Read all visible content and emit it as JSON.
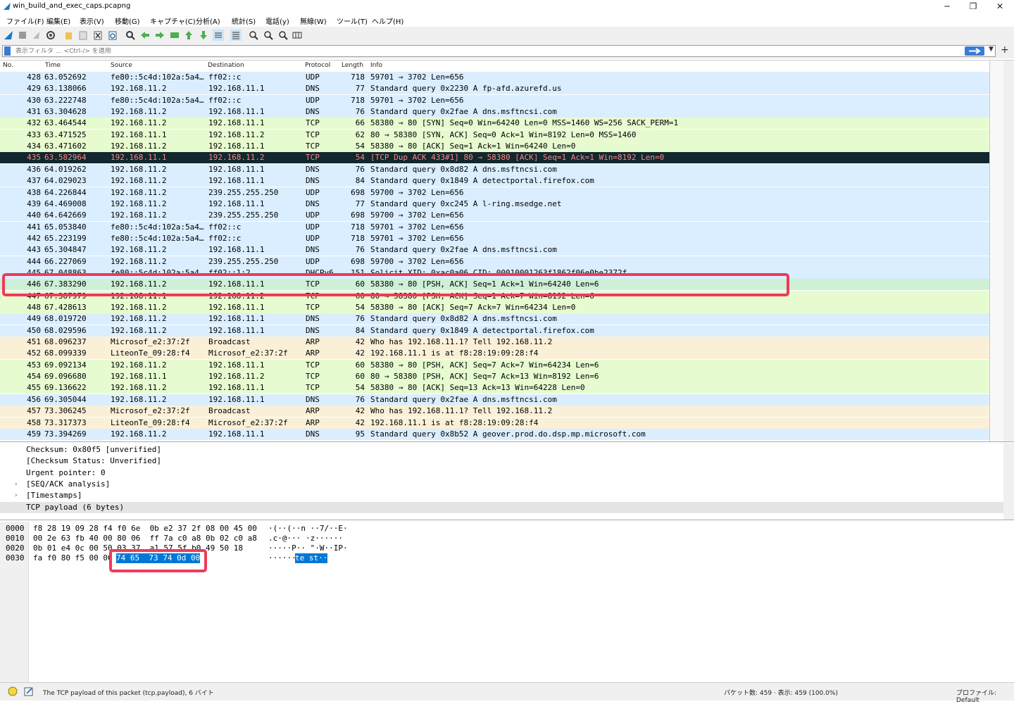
{
  "window": {
    "title": "win_build_and_exec_caps.pcapng",
    "minimize": "─",
    "restore": "❐",
    "close": "✕"
  },
  "menu": [
    "ファイル(F)",
    "編集(E)",
    "表示(V)",
    "移動(G)",
    "キャプチャ(C)",
    "分析(A)",
    "統計(S)",
    "電話(y)",
    "無線(W)",
    "ツール(T)",
    "ヘルプ(H)"
  ],
  "filter": {
    "placeholder": "表示フィルタ … <Ctrl-/> を適用"
  },
  "columns": {
    "no": "No.",
    "time": "Time",
    "source": "Source",
    "destination": "Destination",
    "protocol": "Protocol",
    "length": "Length",
    "info": "Info"
  },
  "packets": [
    {
      "no": "428",
      "time": "63.052692",
      "src": "fe80::5c4d:102a:5a4…",
      "dst": "ff02::c",
      "proto": "UDP",
      "len": "718",
      "info": "59701 → 3702 Len=656",
      "color": "udp"
    },
    {
      "no": "429",
      "time": "63.138066",
      "src": "192.168.11.2",
      "dst": "192.168.11.1",
      "proto": "DNS",
      "len": "77",
      "info": "Standard query 0x2230 A fp-afd.azurefd.us",
      "color": "udp"
    },
    {
      "no": "430",
      "time": "63.222748",
      "src": "fe80::5c4d:102a:5a4…",
      "dst": "ff02::c",
      "proto": "UDP",
      "len": "718",
      "info": "59701 → 3702 Len=656",
      "color": "udp"
    },
    {
      "no": "431",
      "time": "63.304628",
      "src": "192.168.11.2",
      "dst": "192.168.11.1",
      "proto": "DNS",
      "len": "76",
      "info": "Standard query 0x2fae A dns.msftncsi.com",
      "color": "udp"
    },
    {
      "no": "432",
      "time": "63.464544",
      "src": "192.168.11.2",
      "dst": "192.168.11.1",
      "proto": "TCP",
      "len": "66",
      "info": "58380 → 80 [SYN] Seq=0 Win=64240 Len=0 MSS=1460 WS=256 SACK_PERM=1",
      "color": "tcp"
    },
    {
      "no": "433",
      "time": "63.471525",
      "src": "192.168.11.1",
      "dst": "192.168.11.2",
      "proto": "TCP",
      "len": "62",
      "info": "80 → 58380 [SYN, ACK] Seq=0 Ack=1 Win=8192 Len=0 MSS=1460",
      "color": "tcp"
    },
    {
      "no": "434",
      "time": "63.471602",
      "src": "192.168.11.2",
      "dst": "192.168.11.1",
      "proto": "TCP",
      "len": "54",
      "info": "58380 → 80 [ACK] Seq=1 Ack=1 Win=64240 Len=0",
      "color": "tcp"
    },
    {
      "no": "435",
      "time": "63.582964",
      "src": "192.168.11.1",
      "dst": "192.168.11.2",
      "proto": "TCP",
      "len": "54",
      "info": "[TCP Dup ACK 433#1] 80 → 58380 [ACK] Seq=1 Ack=1 Win=8192 Len=0",
      "color": "dark"
    },
    {
      "no": "436",
      "time": "64.019262",
      "src": "192.168.11.2",
      "dst": "192.168.11.1",
      "proto": "DNS",
      "len": "76",
      "info": "Standard query 0x8d82 A dns.msftncsi.com",
      "color": "udp"
    },
    {
      "no": "437",
      "time": "64.029023",
      "src": "192.168.11.2",
      "dst": "192.168.11.1",
      "proto": "DNS",
      "len": "84",
      "info": "Standard query 0x1849 A detectportal.firefox.com",
      "color": "udp"
    },
    {
      "no": "438",
      "time": "64.226844",
      "src": "192.168.11.2",
      "dst": "239.255.255.250",
      "proto": "UDP",
      "len": "698",
      "info": "59700 → 3702 Len=656",
      "color": "udp"
    },
    {
      "no": "439",
      "time": "64.469008",
      "src": "192.168.11.2",
      "dst": "192.168.11.1",
      "proto": "DNS",
      "len": "77",
      "info": "Standard query 0xc245 A l-ring.msedge.net",
      "color": "udp"
    },
    {
      "no": "440",
      "time": "64.642669",
      "src": "192.168.11.2",
      "dst": "239.255.255.250",
      "proto": "UDP",
      "len": "698",
      "info": "59700 → 3702 Len=656",
      "color": "udp"
    },
    {
      "no": "441",
      "time": "65.053840",
      "src": "fe80::5c4d:102a:5a4…",
      "dst": "ff02::c",
      "proto": "UDP",
      "len": "718",
      "info": "59701 → 3702 Len=656",
      "color": "udp"
    },
    {
      "no": "442",
      "time": "65.223199",
      "src": "fe80::5c4d:102a:5a4…",
      "dst": "ff02::c",
      "proto": "UDP",
      "len": "718",
      "info": "59701 → 3702 Len=656",
      "color": "udp"
    },
    {
      "no": "443",
      "time": "65.304847",
      "src": "192.168.11.2",
      "dst": "192.168.11.1",
      "proto": "DNS",
      "len": "76",
      "info": "Standard query 0x2fae A dns.msftncsi.com",
      "color": "udp"
    },
    {
      "no": "444",
      "time": "66.227069",
      "src": "192.168.11.2",
      "dst": "239.255.255.250",
      "proto": "UDP",
      "len": "698",
      "info": "59700 → 3702 Len=656",
      "color": "udp"
    },
    {
      "no": "445",
      "time": "67.048863",
      "src": "fe80::5c4d:102a:5a4…",
      "dst": "ff02::1:2",
      "proto": "DHCPv6",
      "len": "151",
      "info": "Solicit XID: 0xac0a06 CID: 00010001263f1862f06e0be2372f",
      "color": "udp"
    },
    {
      "no": "446",
      "time": "67.383290",
      "src": "192.168.11.2",
      "dst": "192.168.11.1",
      "proto": "TCP",
      "len": "60",
      "info": "58380 → 80 [PSH, ACK] Seq=1 Ack=1 Win=64240 Len=6",
      "color": "selrow"
    },
    {
      "no": "447",
      "time": "67.387979",
      "src": "192.168.11.1",
      "dst": "192.168.11.2",
      "proto": "TCP",
      "len": "60",
      "info": "80 → 58380 [PSH, ACK] Seq=1 Ack=7 Win=8192 Len=6",
      "color": "tcp"
    },
    {
      "no": "448",
      "time": "67.428613",
      "src": "192.168.11.2",
      "dst": "192.168.11.1",
      "proto": "TCP",
      "len": "54",
      "info": "58380 → 80 [ACK] Seq=7 Ack=7 Win=64234 Len=0",
      "color": "tcp"
    },
    {
      "no": "449",
      "time": "68.019720",
      "src": "192.168.11.2",
      "dst": "192.168.11.1",
      "proto": "DNS",
      "len": "76",
      "info": "Standard query 0x8d82 A dns.msftncsi.com",
      "color": "udp"
    },
    {
      "no": "450",
      "time": "68.029596",
      "src": "192.168.11.2",
      "dst": "192.168.11.1",
      "proto": "DNS",
      "len": "84",
      "info": "Standard query 0x1849 A detectportal.firefox.com",
      "color": "udp"
    },
    {
      "no": "451",
      "time": "68.096237",
      "src": "Microsof_e2:37:2f",
      "dst": "Broadcast",
      "proto": "ARP",
      "len": "42",
      "info": "Who has 192.168.11.1? Tell 192.168.11.2",
      "color": "arp"
    },
    {
      "no": "452",
      "time": "68.099339",
      "src": "LiteonTe_09:28:f4",
      "dst": "Microsof_e2:37:2f",
      "proto": "ARP",
      "len": "42",
      "info": "192.168.11.1 is at f8:28:19:09:28:f4",
      "color": "arp"
    },
    {
      "no": "453",
      "time": "69.092134",
      "src": "192.168.11.2",
      "dst": "192.168.11.1",
      "proto": "TCP",
      "len": "60",
      "info": "58380 → 80 [PSH, ACK] Seq=7 Ack=7 Win=64234 Len=6",
      "color": "tcp"
    },
    {
      "no": "454",
      "time": "69.096680",
      "src": "192.168.11.1",
      "dst": "192.168.11.2",
      "proto": "TCP",
      "len": "60",
      "info": "80 → 58380 [PSH, ACK] Seq=7 Ack=13 Win=8192 Len=6",
      "color": "tcp"
    },
    {
      "no": "455",
      "time": "69.136622",
      "src": "192.168.11.2",
      "dst": "192.168.11.1",
      "proto": "TCP",
      "len": "54",
      "info": "58380 → 80 [ACK] Seq=13 Ack=13 Win=64228 Len=0",
      "color": "tcp"
    },
    {
      "no": "456",
      "time": "69.305044",
      "src": "192.168.11.2",
      "dst": "192.168.11.1",
      "proto": "DNS",
      "len": "76",
      "info": "Standard query 0x2fae A dns.msftncsi.com",
      "color": "udp"
    },
    {
      "no": "457",
      "time": "73.306245",
      "src": "Microsof_e2:37:2f",
      "dst": "Broadcast",
      "proto": "ARP",
      "len": "42",
      "info": "Who has 192.168.11.1? Tell 192.168.11.2",
      "color": "arp"
    },
    {
      "no": "458",
      "time": "73.317373",
      "src": "LiteonTe_09:28:f4",
      "dst": "Microsof_e2:37:2f",
      "proto": "ARP",
      "len": "42",
      "info": "192.168.11.1 is at f8:28:19:09:28:f4",
      "color": "arp"
    },
    {
      "no": "459",
      "time": "73.394269",
      "src": "192.168.11.2",
      "dst": "192.168.11.1",
      "proto": "DNS",
      "len": "95",
      "info": "Standard query 0x8b52 A geover.prod.do.dsp.mp.microsoft.com",
      "color": "udp"
    }
  ],
  "details": [
    {
      "arrow": "",
      "text": "Checksum: 0x80f5 [unverified]"
    },
    {
      "arrow": "",
      "text": "[Checksum Status: Unverified]"
    },
    {
      "arrow": "",
      "text": "Urgent pointer: 0"
    },
    {
      "arrow": "›",
      "text": "[SEQ/ACK analysis]"
    },
    {
      "arrow": "›",
      "text": "[Timestamps]"
    },
    {
      "arrow": "",
      "text": "TCP payload (6 bytes)"
    }
  ],
  "bytes": [
    {
      "offset": "0000",
      "hex": "f8 28 19 09 28 f4 f0 6e  0b e2 37 2f 08 00 45 00",
      "ascii": "·(··(··n ··7/··E·"
    },
    {
      "offset": "0010",
      "hex": "00 2e 63 fb 40 00 80 06  ff 7a c0 a8 0b 02 c0 a8",
      "ascii": ".c·@··· ·z······"
    },
    {
      "offset": "0020",
      "hex": "0b 01 e4 0c 00 50 03 37  a1 57 5f b0 49 50 18",
      "ascii": "·····P·· \"·W··IP·"
    },
    {
      "offset": "0030",
      "hex": "fa f0 80 f5 00 00",
      "hl_hex": "74 65  73 74 0d 00",
      "ascii": "······",
      "hl_ascii": "te st··"
    }
  ],
  "status": {
    "message": "The TCP payload of this packet (tcp.payload), 6 バイト",
    "counts": "パケット数: 459 · 表示: 459 (100.0%)",
    "profile": "プロファイル: Default"
  }
}
